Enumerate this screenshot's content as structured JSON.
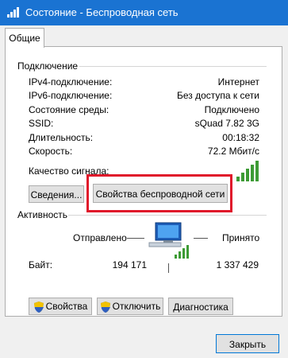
{
  "window": {
    "title": "Состояние - Беспроводная сеть"
  },
  "tabs": [
    {
      "label": "Общие",
      "active": true
    }
  ],
  "connection": {
    "section_title": "Подключение",
    "rows": [
      {
        "label": "IPv4-подключение:",
        "value": "Интернет"
      },
      {
        "label": "IPv6-подключение:",
        "value": "Без доступа к сети"
      },
      {
        "label": "Состояние среды:",
        "value": "Подключено"
      },
      {
        "label": "SSID:",
        "value": "sQuad 7.82 3G"
      },
      {
        "label": "Длительность:",
        "value": "00:18:32"
      },
      {
        "label": "Скорость:",
        "value": "72.2 Мбит/с"
      }
    ],
    "signal_label": "Качество сигнала:",
    "signal_bars": 5,
    "signal_bars_total": 5,
    "details_button": "Сведения...",
    "wireless_props_button": "Свойства беспроводной сети"
  },
  "activity": {
    "section_title": "Активность",
    "sent_label": "Отправлено",
    "received_label": "Принято",
    "bytes_label": "Байт:",
    "bytes_sent": "194 171",
    "bytes_received": "1 337 429"
  },
  "buttons": {
    "properties": "Свойства",
    "disconnect": "Отключить",
    "diagnostics": "Диагностика",
    "close": "Закрыть"
  },
  "colors": {
    "titlebar": "#1a73d2",
    "signal_green": "#3d9b35",
    "highlight_red": "#e0162a",
    "shield_blue": "#2f5fbf",
    "shield_yellow": "#f2c200"
  },
  "icons": {
    "title": "wifi-signal-icon",
    "activity": "network-computer-icon",
    "buttons": "uac-shield-icon"
  }
}
